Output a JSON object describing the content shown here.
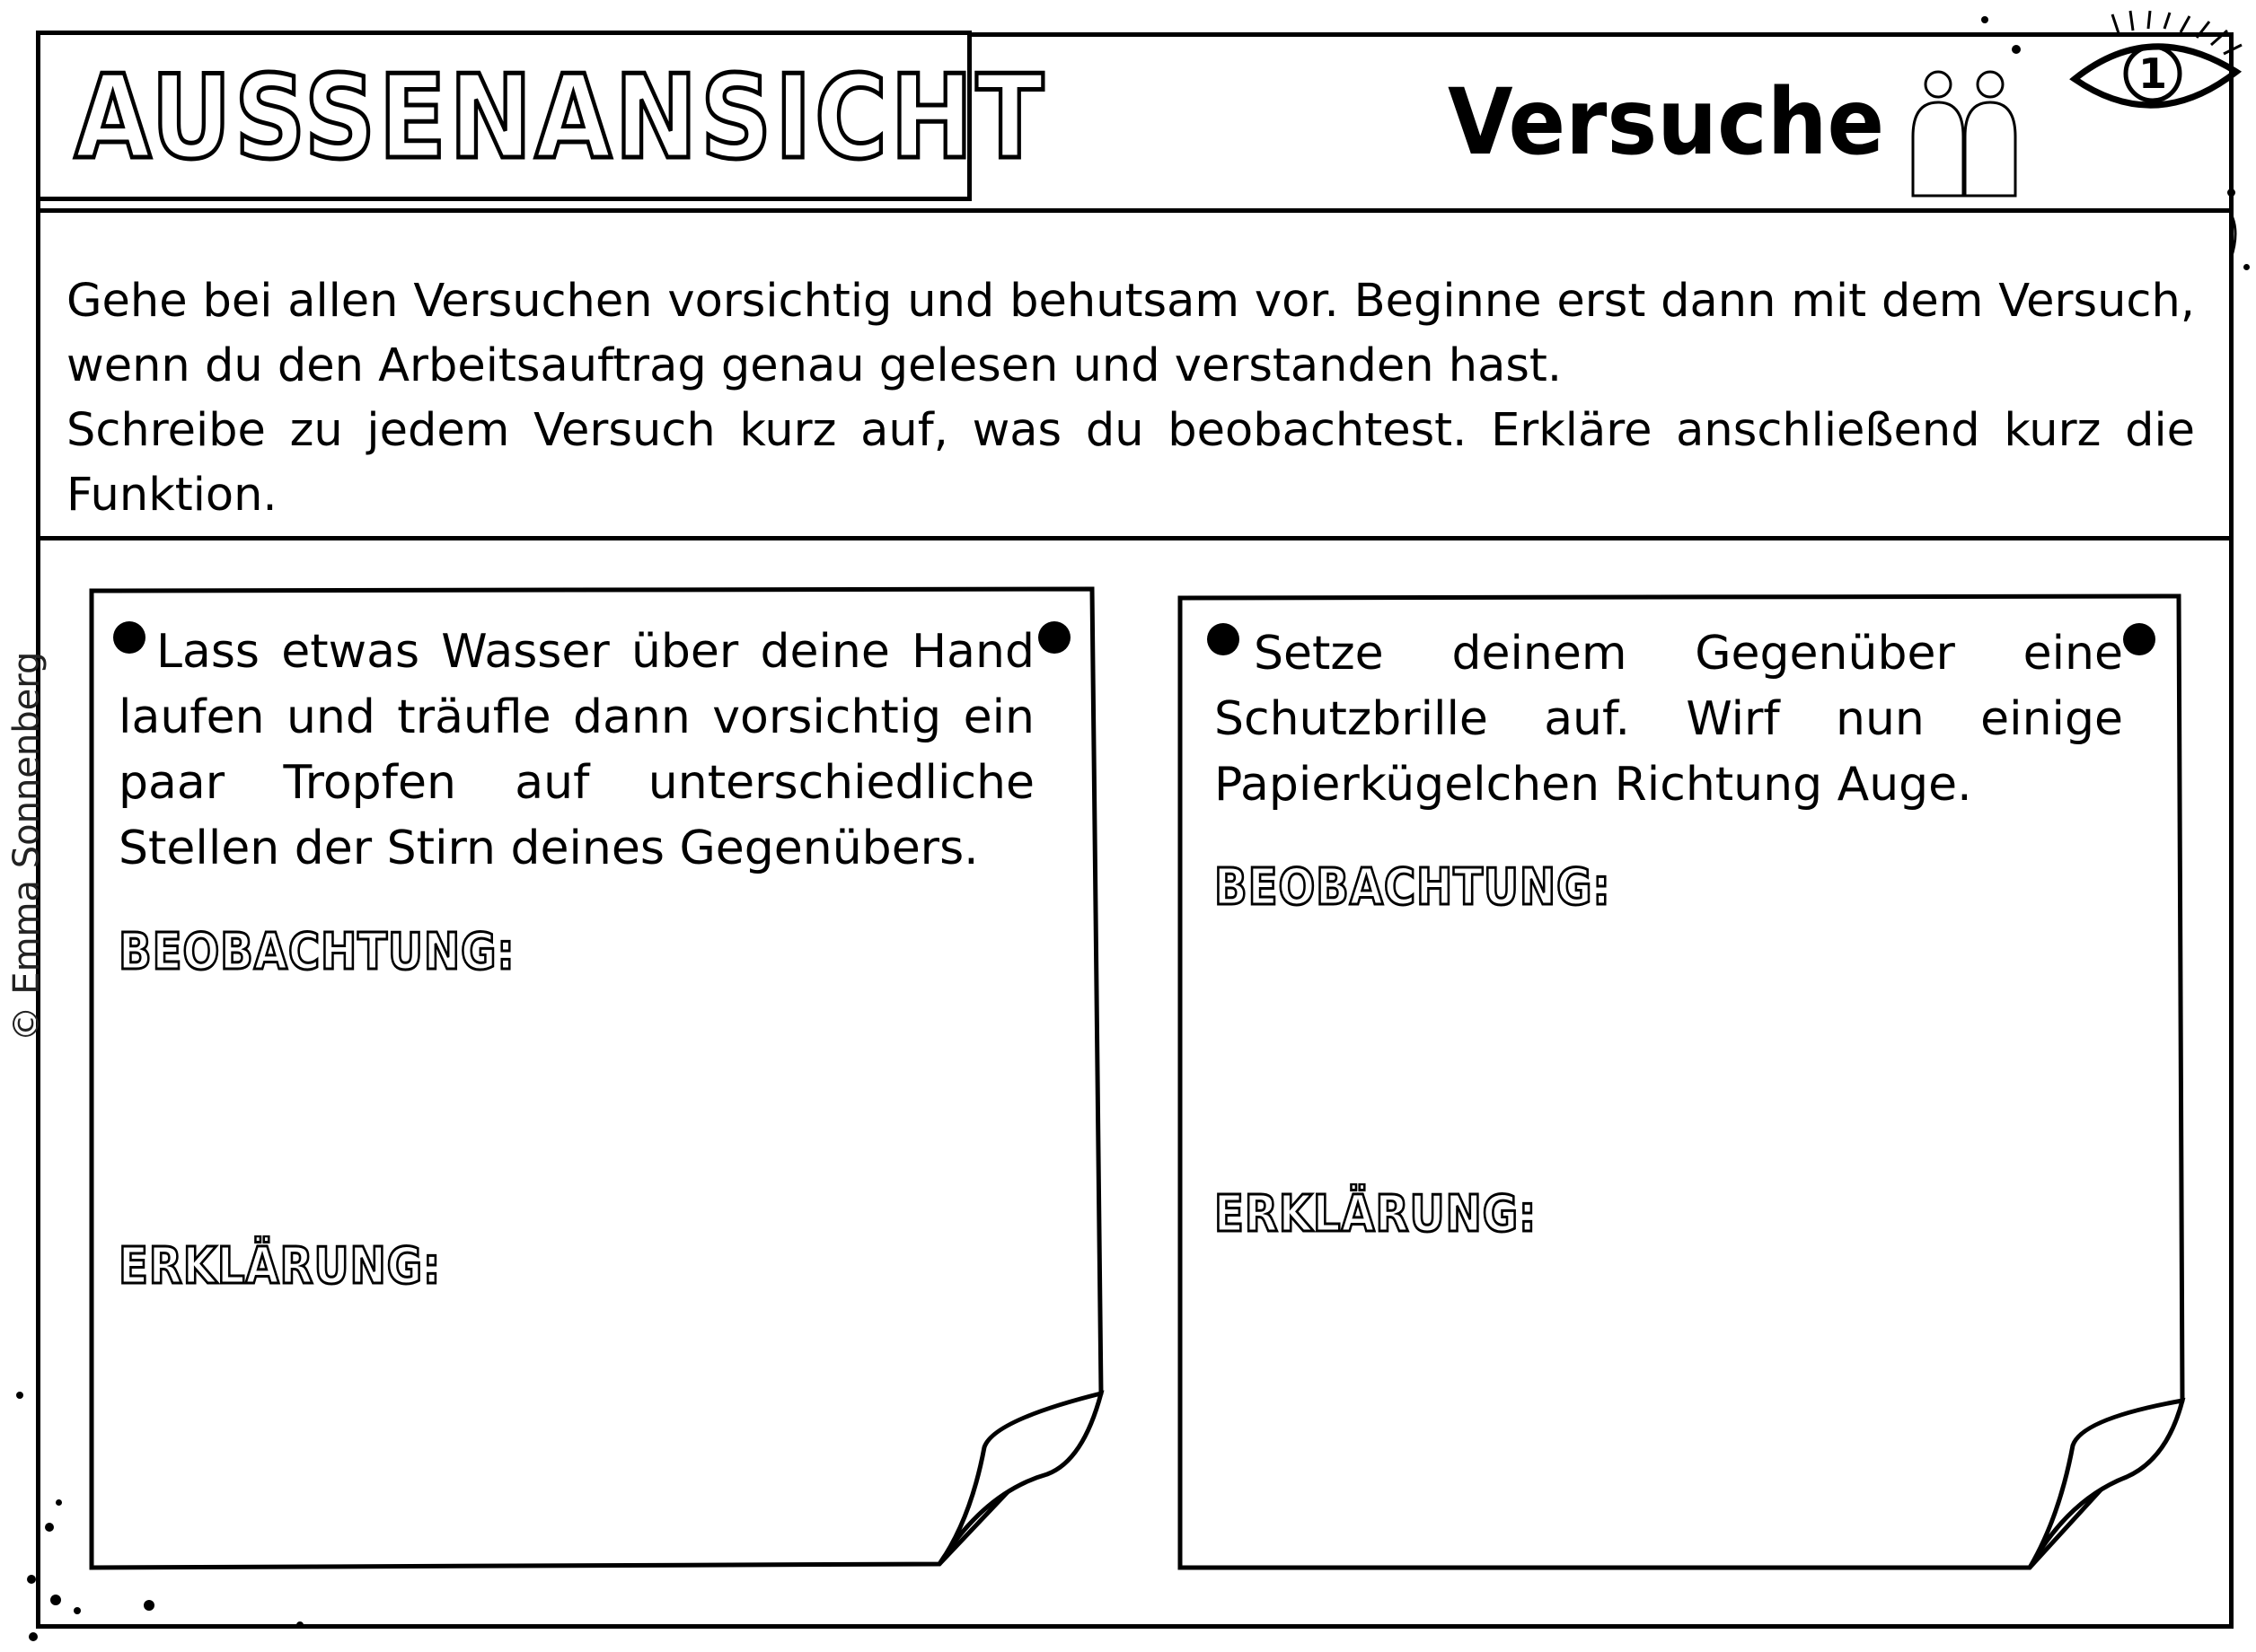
{
  "header": {
    "title": "AUSSENANSICHT",
    "heading": "Versuche",
    "page_number": "1"
  },
  "intro": {
    "paragraph1": "Gehe bei allen Versuchen vorsichtig und behutsam vor. Beginne erst dann mit dem Versuch, wenn du den Arbeitsauftrag genau gelesen und verstanden hast.",
    "paragraph2": "Schreibe zu jedem Versuch kurz auf, was du beobachtest. Erkläre anschließend kurz die Funktion."
  },
  "cards": [
    {
      "task": "Lass etwas Wasser über deine Hand laufen und träufle dann vorsichtig ein paar Tropfen auf unterschiedliche Stellen der Stirn deines Gegenübers.",
      "observation_label": "BEOBACHTUNG:",
      "explanation_label": "ERKLÄRUNG:"
    },
    {
      "task": "Setze deinem Gegenüber eine Schutzbrille auf. Wirf nun einige Papierkügelchen Richtung Auge.",
      "observation_label": "BEOBACHTUNG:",
      "explanation_label": "ERKLÄRUNG:"
    }
  ],
  "copyright": "© Emma Sonnenberg",
  "icons": {
    "people": "two-people-icon",
    "eye": "eye-icon",
    "bullet": "bullet-dot-icon",
    "pin": "pin-dot-icon"
  }
}
